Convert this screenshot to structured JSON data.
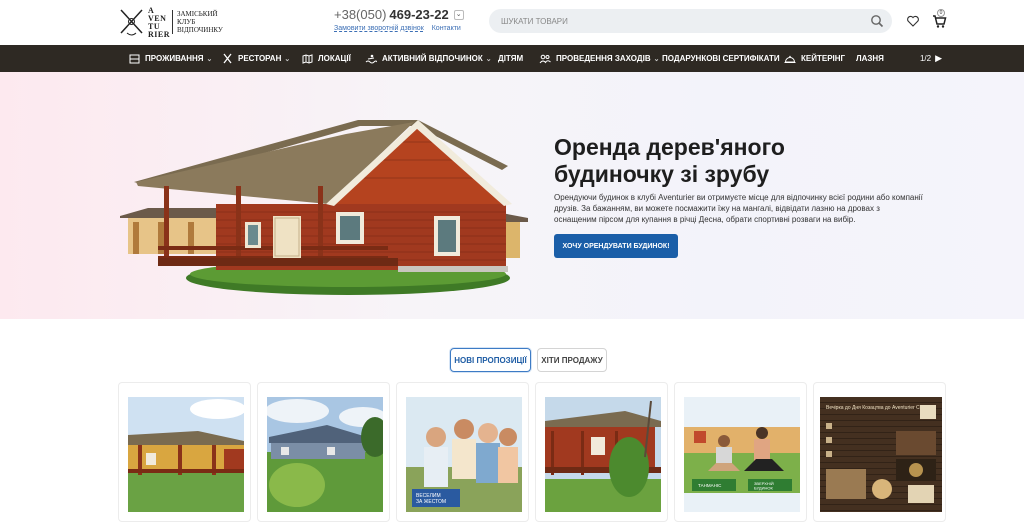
{
  "header": {
    "logo": {
      "mark_word": "A\nVEN\nTU\nRIER",
      "tagline": "Заміський\nклуб\nвідпочинку"
    },
    "phone": {
      "prefix": "+38(050)",
      "number": "469-23-22",
      "chevron": "⌄"
    },
    "links": {
      "callback": "Замовити зворотній дзвінок",
      "contacts": "Контакти"
    },
    "search": {
      "placeholder": "ШУКАТИ ТОВАРИ"
    },
    "cart_count": "0"
  },
  "nav": {
    "items": [
      {
        "label": "ПРОЖИВАННЯ",
        "icon": "bed-icon",
        "dropdown": true
      },
      {
        "label": "РЕСТОРАН",
        "icon": "cutlery-icon",
        "dropdown": true
      },
      {
        "label": "ЛОКАЦІЇ",
        "icon": "map-icon",
        "dropdown": false
      },
      {
        "label": "АКТИВНИЙ ВІДПОЧИНОК",
        "icon": "activity-icon",
        "dropdown": true
      },
      {
        "label": "ДІТЯМ",
        "icon": "",
        "dropdown": false
      },
      {
        "label": "ПРОВЕДЕННЯ ЗАХОДІВ",
        "icon": "people-icon",
        "dropdown": true
      },
      {
        "label": "ПОДАРУНКОВІ СЕРТИФІКАТИ",
        "icon": "",
        "dropdown": false
      },
      {
        "label": "КЕЙТЕРІНГ",
        "icon": "cloche-icon",
        "dropdown": false
      },
      {
        "label": "ЛАЗНЯ",
        "icon": "",
        "dropdown": false
      }
    ],
    "pager": "1/2",
    "caret": "⌄",
    "next_arrow": "▶"
  },
  "hero": {
    "title": "Оренда дерев'яного будиночку зі зрубу",
    "description": "Орендуючи будинок в клубі Aventurier ви отримуєте місце для відпочинку всієї родини або компанії друзів. За бажанням, ви можете посмажити їжу на мангалі, відвідати лазню на дровах з оснащеним пірсом для купання в річці Десна, обрати спортивні розваги на вибір.",
    "button": "Хочу орендувати будинок!"
  },
  "tabs": {
    "new": "Нові пропозиції",
    "hits": "Хіти продажу"
  },
  "product_badges": {
    "card3": "ВЕСЕЛИМ\nЗА ЖЕСТОМ",
    "card5": [
      "ТАНМАНІС",
      "ЗВЕРХНІЙ\nБУДИНОК"
    ],
    "card6": "Вечірка до Дня Козацтва до Aventurier Club"
  },
  "colors": {
    "nav_bg": "#2e2923",
    "accent": "#1a5ea8",
    "hero_bg_left": "#fde9ef",
    "hero_bg_right": "#f5f4fb"
  }
}
